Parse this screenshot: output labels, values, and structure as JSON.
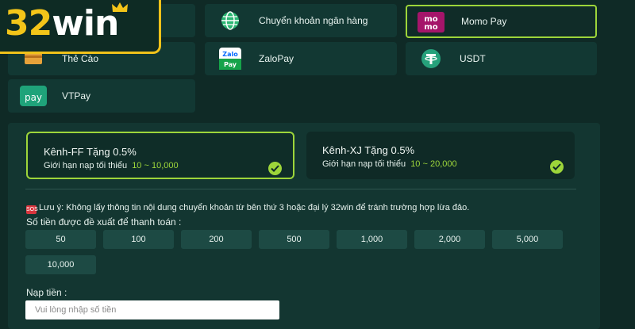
{
  "brand": {
    "logo_main": "32",
    "logo_win": "win"
  },
  "methods": [
    {
      "id": "bank",
      "label": "Chuyển khoản ngân hàng",
      "icon": "globe-icon"
    },
    {
      "id": "momo",
      "label": "Momo Pay",
      "icon": "momo-logo-icon",
      "selected": true
    },
    {
      "id": "card",
      "label": "Thẻ Cào",
      "icon": "card-icon"
    },
    {
      "id": "zalopay",
      "label": "ZaloPay",
      "icon": "zalopay-logo-icon"
    },
    {
      "id": "usdt",
      "label": "USDT",
      "icon": "tether-icon"
    },
    {
      "id": "vtpay",
      "label": "VTPay",
      "icon": "vtpay-logo-icon"
    }
  ],
  "channels": [
    {
      "title": "Kênh-FF Tặng 0.5%",
      "limit_text": "Giới hạn nạp tối thiểu",
      "range": "10 ~ 10,000",
      "selected": true
    },
    {
      "title": "Kênh-XJ Tặng 0.5%",
      "limit_text": "Giới hạn nạp tối thiểu",
      "range": "10 ~ 20,000",
      "selected": false
    }
  ],
  "note": {
    "badge": "SOS",
    "text": "Lưu ý: Không lấy thông tin nội dung chuyển khoản từ bên thứ 3 hoặc đại lý 32win để tránh trường hợp lừa đảo."
  },
  "suggest_label": "Số tiền được đề xuất để thanh toán :",
  "amounts": [
    "50",
    "100",
    "200",
    "500",
    "1,000",
    "2,000",
    "5,000",
    "10,000"
  ],
  "deposit": {
    "label": "Nạp tiền :",
    "placeholder": "Vui lòng nhập số tiền"
  },
  "colors": {
    "background": "#0f2a26",
    "accent": "#9dd53a",
    "brand": "#f3c519"
  }
}
